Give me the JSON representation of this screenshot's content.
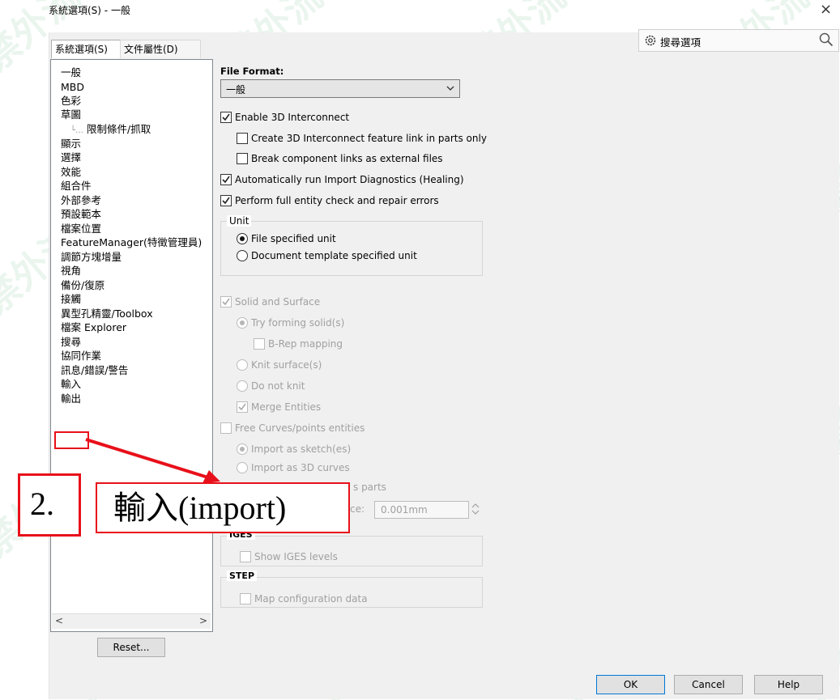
{
  "window": {
    "title": "系統選項(S) - 一般",
    "close": "×"
  },
  "tabs": [
    "系統選項(S)",
    "文件屬性(D)"
  ],
  "search": {
    "label": "搜尋選項",
    "settings_icon": "gear-icon",
    "search_icon": "magnifier-icon"
  },
  "tree": {
    "items": [
      "一般",
      "MBD",
      "色彩",
      "草圖",
      "限制條件/抓取",
      "顯示",
      "選擇",
      "效能",
      "組合件",
      "外部參考",
      "預設範本",
      "檔案位置",
      "FeatureManager(特徵管理員)",
      "調節方塊增量",
      "視角",
      "備份/復原",
      "接觸",
      "異型孔精靈/Toolbox",
      "檔案 Explorer",
      "搜尋",
      "協同作業",
      "訊息/錯誤/警告",
      "輸入",
      "輸出"
    ],
    "selected_index": 22
  },
  "scroll": {
    "left": "<",
    "right": ">"
  },
  "reset_label": "Reset...",
  "file_format": {
    "label": "File Format:",
    "value": "一般"
  },
  "checks": {
    "enable_3d": "Enable 3D Interconnect",
    "feature_link": "Create 3D Interconnect feature link in parts only",
    "break_links": "Break component links as external files",
    "auto_diag": "Automatically run Import Diagnostics (Healing)",
    "full_check": "Perform full entity check and repair errors"
  },
  "checked": {
    "enable_3d": true,
    "feature_link": false,
    "break_links": false,
    "auto_diag": true,
    "full_check": true
  },
  "unit": {
    "title": "Unit",
    "file_unit": "File specified unit",
    "doc_unit": "Document template specified unit",
    "selected": "file_unit"
  },
  "solid": {
    "solid_surface": "Solid and Surface",
    "try_forming": "Try forming solid(s)",
    "brep": "B-Rep mapping",
    "knit": "Knit surface(s)",
    "no_knit": "Do not knit",
    "merge": "Merge Entities"
  },
  "curves": {
    "free_curves": "Free Curves/points entities",
    "as_sketch": "Import as sketch(es)",
    "as_3d": "Import as 3D curves",
    "as_parts_partial": "s parts",
    "tolerance_partial": "ce:",
    "tolerance_value": "0.001mm"
  },
  "iges": {
    "title": "IGES",
    "levels": "Show IGES levels"
  },
  "step": {
    "title": "STEP",
    "map_config": "Map configuration data"
  },
  "buttons": {
    "ok": "OK",
    "cancel": "Cancel",
    "help": "Help"
  },
  "annotation": {
    "step": "2.",
    "text": "輸入(import)",
    "color": "#e8101a"
  },
  "watermark": {
    "text": "嚴禁外流機密",
    "color": "#2e9e5b"
  }
}
